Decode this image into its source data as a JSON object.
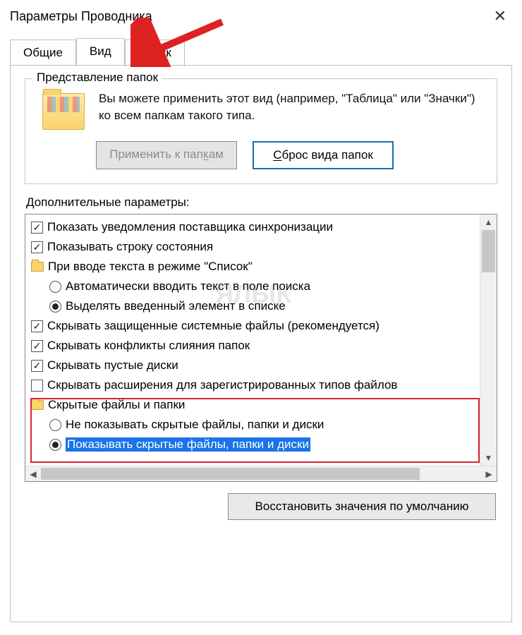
{
  "window": {
    "title": "Параметры Проводника"
  },
  "tabs": {
    "general": "Общие",
    "view": "Вид",
    "search": "Поиск"
  },
  "folderViews": {
    "legend": "Представление папок",
    "description": "Вы можете применить этот вид (например, \"Таблица\" или \"Значки\") ко всем папкам такого типа.",
    "applyBtn": "Применить к папкам",
    "resetBtn": "Сброс вида папок"
  },
  "advanced": {
    "label": "Дополнительные параметры:",
    "items": [
      {
        "type": "check",
        "checked": true,
        "indent": 0,
        "text": "Показать уведомления поставщика синхронизации"
      },
      {
        "type": "check",
        "checked": true,
        "indent": 0,
        "text": "Показывать строку состояния"
      },
      {
        "type": "folder",
        "indent": 0,
        "text": "При вводе текста в режиме \"Список\""
      },
      {
        "type": "radio",
        "checked": false,
        "indent": 1,
        "text": "Автоматически вводить текст в поле поиска"
      },
      {
        "type": "radio",
        "checked": true,
        "indent": 1,
        "text": "Выделять введенный элемент в списке"
      },
      {
        "type": "check",
        "checked": true,
        "indent": 0,
        "text": "Скрывать защищенные системные файлы (рекомендуется)"
      },
      {
        "type": "check",
        "checked": true,
        "indent": 0,
        "text": "Скрывать конфликты слияния папок"
      },
      {
        "type": "check",
        "checked": true,
        "indent": 0,
        "text": "Скрывать пустые диски"
      },
      {
        "type": "check",
        "checked": false,
        "indent": 0,
        "text": "Скрывать расширения для зарегистрированных типов файлов"
      },
      {
        "type": "folder",
        "indent": 0,
        "text": "Скрытые файлы и папки"
      },
      {
        "type": "radio",
        "checked": false,
        "indent": 1,
        "text": "Не показывать скрытые файлы, папки и диски"
      },
      {
        "type": "radio",
        "checked": true,
        "indent": 1,
        "text": "Показывать скрытые файлы, папки и диски",
        "selected": true
      }
    ]
  },
  "restoreDefaults": "Восстановить значения по умолчанию",
  "watermark": "ЯБЛЫК"
}
